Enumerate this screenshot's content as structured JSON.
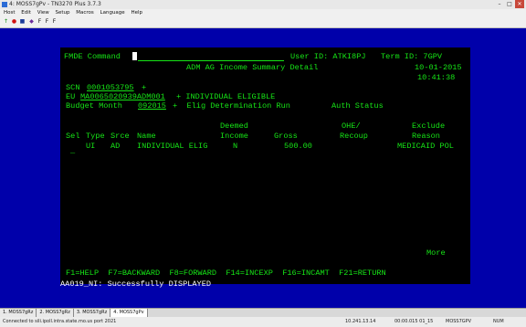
{
  "window": {
    "title": "4: MOSS7gPv - TN3270 Plus 3.7.3",
    "min": "–",
    "max": "□",
    "close": "✕"
  },
  "menu": [
    "Host",
    "Edit",
    "View",
    "Setup",
    "Macros",
    "Language",
    "Help"
  ],
  "toolbar": {
    "items": [
      "↑",
      "●",
      "■",
      "◆",
      "F",
      "F",
      "F"
    ]
  },
  "terminal": {
    "command_label": "FMDE Command",
    "user_label": "User ID: ATKI8PJ",
    "term_label": "Term ID: 7GPV",
    "screen_title": "ADM AG Income Summary Detail",
    "date": "10-01-2015",
    "time": "10:41:38",
    "scn_label": "SCN",
    "scn_value": "0001053795",
    "scn_plus": "+",
    "eu_label": "EU",
    "eu_value": "MA0065020939ADM001",
    "eu_desc": "+ INDIVIDUAL ELIGIBLE",
    "budget_label": "Budget Month",
    "budget_value": "092015",
    "budget_rest": "+  Elig Determination Run",
    "auth_label": "Auth Status",
    "headers_top": {
      "deemed": "Deemed",
      "ohe": "OHE/",
      "exclude": "Exclude"
    },
    "headers": {
      "sel": "Sel",
      "type": "Type",
      "srce": "Srce",
      "name": "Name",
      "income": "Income",
      "gross": "Gross",
      "recoup": "Recoup",
      "reason": "Reason"
    },
    "rows": [
      {
        "sel": "_",
        "type": "UI",
        "srce": "AD",
        "name": "INDIVIDUAL ELIG",
        "income": "N",
        "gross": "500.00",
        "reason": "MEDICAID POL"
      }
    ],
    "more": "More",
    "fkeys": "F1=HELP  F7=BACKWARD  F8=FORWARD  F14=INCEXP  F16=INCAMT  F21=RETURN",
    "message": "AA019_NI: Successfully DISPLAYED"
  },
  "tabs": [
    "1. MOSS7gRz",
    "2. MOSS7gRz",
    "3. MOSS7gRz",
    "4. MOSS7gPv"
  ],
  "status": {
    "connection": "Connected to sili.ipoll.intra.state.mo.us port 2021",
    "ip": "10.241.13.14",
    "pos": "00:00.015  01_15",
    "session": "MOSS7GPV",
    "num": "NUM"
  },
  "colors": {
    "screen_bg": "#0000aa",
    "term_bg": "#000000",
    "green": "#16e616",
    "yellow": "#ffff4a"
  }
}
